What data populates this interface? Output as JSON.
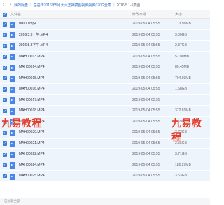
{
  "breadcrumb": {
    "back": "‹",
    "forward": "›",
    "items": [
      "我的网盘",
      "岳岳传2016年5月大六王神摸图视频视频370G全集",
      "2016.5.1-5集图"
    ]
  },
  "table_header": {
    "name": "文件名",
    "date": "修改日期",
    "size": "大小"
  },
  "files": [
    {
      "name": "00000.mp4",
      "date": "2019-05-04 05:55",
      "size": "713.56MB"
    },
    {
      "name": "2016.5.3上午.MP4",
      "date": "2019-05-04 05:55",
      "size": "3.00GB"
    },
    {
      "name": "2016.5.3下午.MP4",
      "date": "2019-05-04 05:55",
      "size": "2.87GB"
    },
    {
      "name": "MAH00013.MP4",
      "date": "2019-05-04 05:55",
      "size": "52.00MB"
    },
    {
      "name": "MAH00014.MP4",
      "date": "2019-05-04 05:55",
      "size": "80.45MB"
    },
    {
      "name": "MAH00015.MP4",
      "date": "2019-05-04 05:55",
      "size": "704.03MB"
    },
    {
      "name": "MAH00016.MP4",
      "date": "2019-05-04 05:55",
      "size": "1.68GB"
    },
    {
      "name": "MAH00017.MP4",
      "date": "2019-05-04 05:55",
      "size": ""
    },
    {
      "name": "MAH00018.MP4",
      "date": "2019-05-04 05:55",
      "size": "372.81MB"
    },
    {
      "name": "MAH00019.MP4",
      "date": "2019-05-04 05:55",
      "size": "3.59GB"
    },
    {
      "name": "MAH00020.MP4",
      "date": "2019-05-04 05:55",
      "size": "3.73GB"
    },
    {
      "name": "MAH00021.MP4",
      "date": "2019-05-04 05:55",
      "size": "2.85GB"
    },
    {
      "name": "MAH00022.MP4",
      "date": "2019-05-04 05:55",
      "size": "3.71GB"
    },
    {
      "name": "MAH00024.MP4",
      "date": "2019-05-04 05:55",
      "size": "182.27MB"
    },
    {
      "name": "MAH00025.MP4",
      "date": "2019-05-04 05:55",
      "size": "3.53GB"
    }
  ],
  "watermark": "九易教程",
  "footer": "已加载全部",
  "colors": {
    "accent": "#3a7fd9",
    "row_bg": "#eef4fc",
    "watermark": "#e03c2d"
  }
}
